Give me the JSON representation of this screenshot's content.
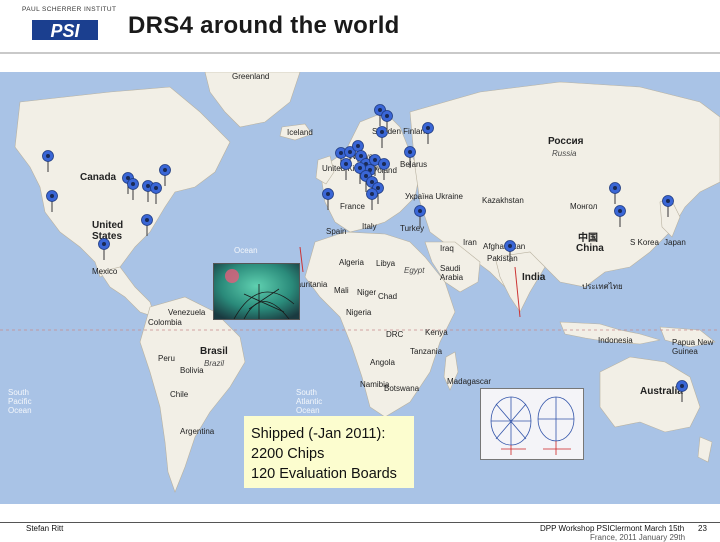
{
  "header": {
    "logo_text": "PAUL SCHERRER INSTITUT",
    "logo_mark": "PSI",
    "title": "DRS4 around the world"
  },
  "map": {
    "labels": {
      "greenland": "Greenland",
      "iceland": "Iceland",
      "sweden_finland": "Sweden\nFinland",
      "norway": "Norway",
      "uk": "United\nKingdom",
      "poland": "Poland",
      "belarus": "Belarus",
      "ukraine": "Україна\nUkraine",
      "france": "France",
      "italy": "Italy",
      "spain": "Spain",
      "turkey": "Turkey",
      "russia": "Россия",
      "russia_latin": "Russia",
      "kazakhstan": "Kazakhstan",
      "mongolia": "Монгол",
      "mongolia2": "Mongolia",
      "china_local": "中国",
      "china": "China",
      "skorea": "S Korea",
      "japan": "Japan",
      "canada": "Canada",
      "usa": "United\nStates",
      "mexico": "Mexico",
      "venezuela": "Venezuela",
      "colombia": "Colombia",
      "peru": "Peru",
      "brazil": "Brasil",
      "brazil2": "Brazil",
      "bolivia": "Bolivia",
      "chile": "Chile",
      "argentina": "Argentina",
      "south_pacific": "South\nPacific\nOcean",
      "south_atlantic": "South\nAtlantic\nOcean",
      "algeria": "Algeria",
      "libya": "Libya",
      "egypt": "Egypt",
      "mauritania": "Mauritania",
      "mali": "Mali",
      "niger": "Niger",
      "chad": "Chad",
      "nigeria": "Nigeria",
      "congo": "DRC",
      "kenya": "Kenya",
      "tanzania": "Tanzania",
      "angola": "Angola",
      "namibia": "Namibia",
      "botswana": "Botswana",
      "madagascar": "Madagascar",
      "iraq": "Iraq",
      "iran": "Iran",
      "saudi": "Saudi\nArabia",
      "afghanistan": "Afghanistan",
      "pakistan": "Pakistan",
      "india": "India",
      "thailand": "ประเทศไทย",
      "indonesia": "Indonesia",
      "png": "Papua New\nGuinea",
      "australia": "Australia",
      "ocean": "Ocean"
    },
    "pin_color": "#3a66d6"
  },
  "shipped_box": {
    "line1": "Shipped (-Jan 2011):",
    "line2": "2200 Chips",
    "line3": "120 Evaluation Boards"
  },
  "footer": {
    "author": "Stefan Ritt",
    "event": "DPP Workshop PSIClermont March 15th",
    "event2": "France, 2011 January 29th",
    "page": "23"
  }
}
